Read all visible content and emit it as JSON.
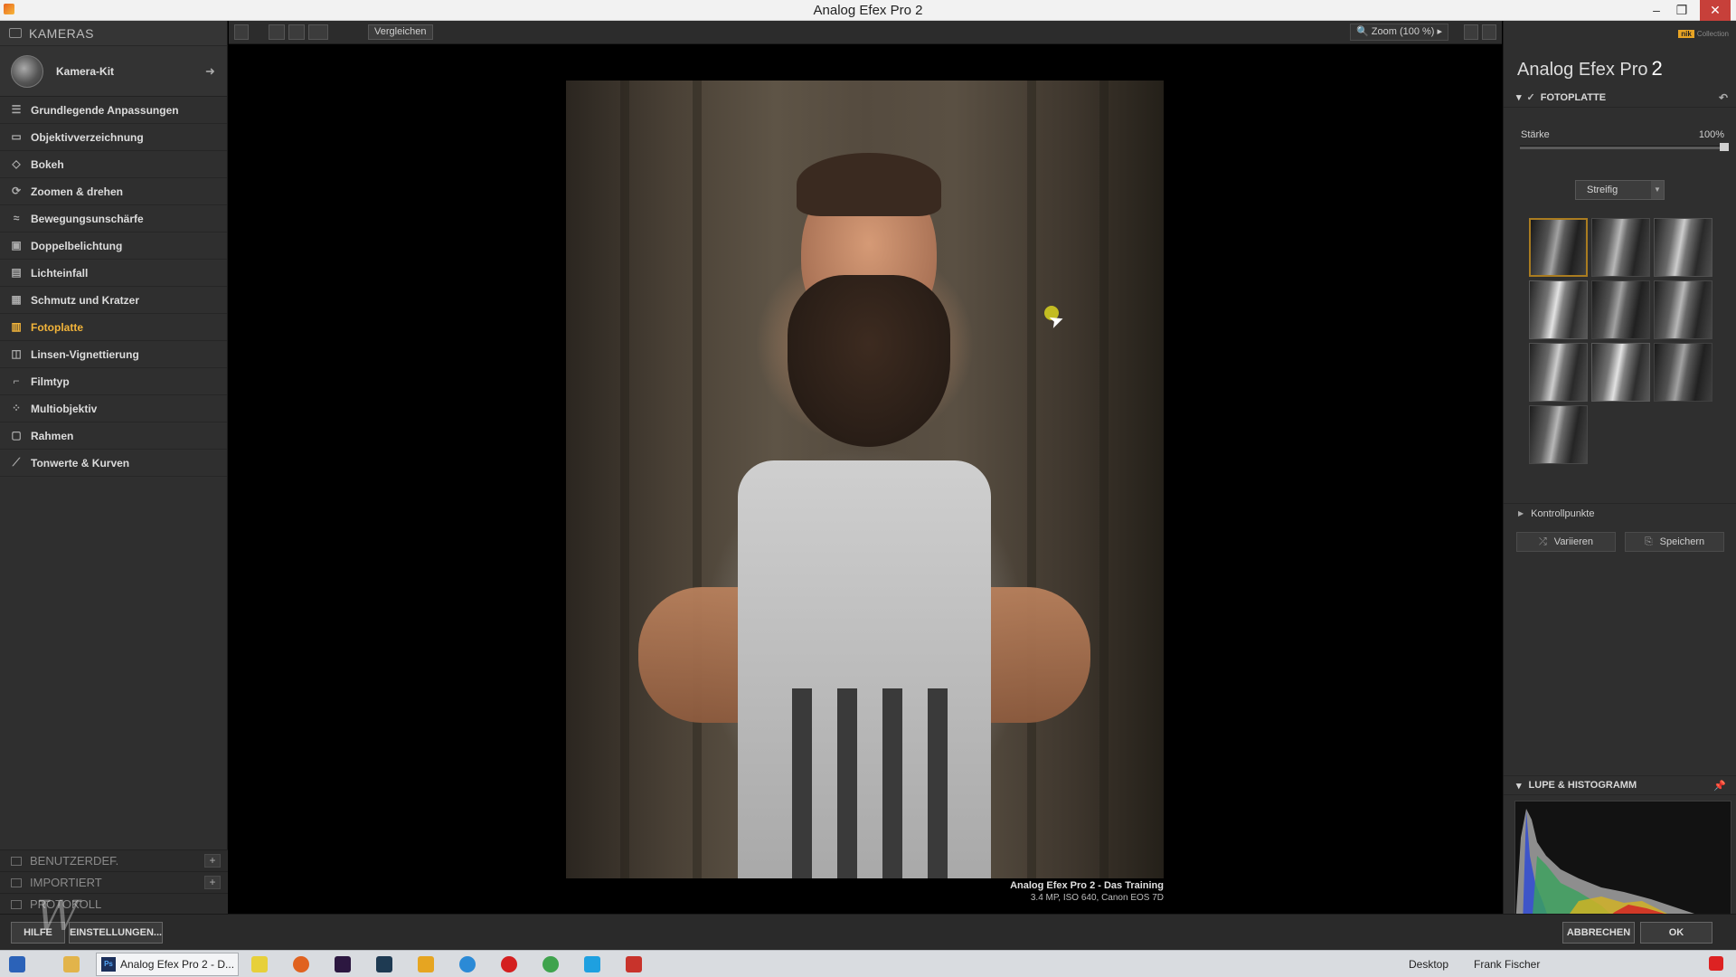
{
  "window": {
    "title": "Analog Efex Pro 2"
  },
  "left_panel": {
    "header": "KAMERAS",
    "camera_kit": "Kamera-Kit",
    "tools": [
      {
        "label": "Grundlegende Anpassungen",
        "icon": "sliders-icon"
      },
      {
        "label": "Objektivverzeichnung",
        "icon": "distortion-icon"
      },
      {
        "label": "Bokeh",
        "icon": "bokeh-icon"
      },
      {
        "label": "Zoomen & drehen",
        "icon": "rotate-icon"
      },
      {
        "label": "Bewegungsunschärfe",
        "icon": "motion-icon"
      },
      {
        "label": "Doppelbelichtung",
        "icon": "double-exposure-icon"
      },
      {
        "label": "Lichteinfall",
        "icon": "light-leak-icon"
      },
      {
        "label": "Schmutz und Kratzer",
        "icon": "dirt-icon"
      },
      {
        "label": "Fotoplatte",
        "icon": "plate-icon",
        "active": true
      },
      {
        "label": "Linsen-Vignettierung",
        "icon": "vignette-icon"
      },
      {
        "label": "Filmtyp",
        "icon": "film-icon"
      },
      {
        "label": "Multiobjektiv",
        "icon": "multilens-icon"
      },
      {
        "label": "Rahmen",
        "icon": "frame-icon"
      },
      {
        "label": "Tonwerte & Kurven",
        "icon": "curves-icon"
      }
    ],
    "user_defined": "BENUTZERDEF.",
    "imported": "IMPORTIERT",
    "protocol": "PROTOKOLL"
  },
  "toolbar": {
    "compare": "Vergleichen",
    "zoom": "Zoom (100 %)"
  },
  "photo": {
    "caption_title": "Analog Efex Pro 2 - Das Training",
    "caption_meta": "3.4 MP, ISO 640, Canon EOS 7D"
  },
  "right_panel": {
    "brand": "Collection",
    "app_title": "Analog Efex Pro",
    "app_version": "2",
    "section": "FOTOPLATTE",
    "strength_label": "Stärke",
    "strength_value": "100%",
    "strength_fraction": 1.0,
    "preset_dropdown": "Streifig",
    "thumbnail_count": 10,
    "selected_thumbnail": 0,
    "control_points": "Kontrollpunkte",
    "vary": "Variieren",
    "save": "Speichern",
    "loupe_section": "LUPE & HISTOGRAMM"
  },
  "bottom": {
    "help": "HILFE",
    "settings": "EINSTELLUNGEN...",
    "cancel": "ABBRECHEN",
    "ok": "OK"
  },
  "taskbar": {
    "active_app": "Analog Efex Pro 2 - D...",
    "desktop": "Desktop",
    "user": "Frank Fischer"
  },
  "colors": {
    "accent": "#f2b43a",
    "panel": "#2f2f2f",
    "canvas": "#000000"
  }
}
